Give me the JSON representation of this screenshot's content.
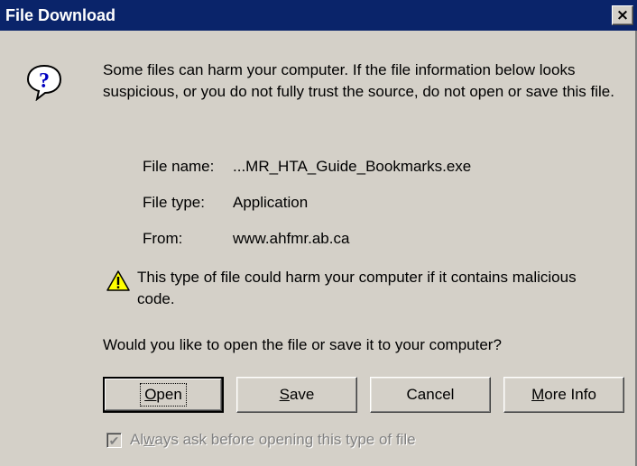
{
  "window": {
    "title": "File Download",
    "close_glyph": "✕"
  },
  "intro": "Some files can harm your computer. If the file information below looks suspicious, or you do not fully trust the source, do not open or save this file.",
  "file_info": {
    "name_label": "File name:",
    "name_value": "...MR_HTA_Guide_Bookmarks.exe",
    "type_label": "File type:",
    "type_value": "Application",
    "from_label": "From:",
    "from_value": "www.ahfmr.ab.ca"
  },
  "warning": "This type of file could harm your computer if it contains malicious code.",
  "question": "Would you like to open the file or save it to your computer?",
  "buttons": {
    "open": {
      "accel": "O",
      "rest": "pen"
    },
    "save": {
      "accel": "S",
      "rest": "ave"
    },
    "cancel": "Cancel",
    "more_info": {
      "accel": "M",
      "rest": "ore Info"
    }
  },
  "always_ask": {
    "pre": "Al",
    "accel": "w",
    "rest": "ays ask before opening this type of file",
    "checked": true
  },
  "icons": {
    "question": "question-icon",
    "warning": "warning-icon"
  },
  "colors": {
    "titlebar": "#0a246a",
    "dialog": "#d4d0c8",
    "disabled_text": "#808080"
  }
}
